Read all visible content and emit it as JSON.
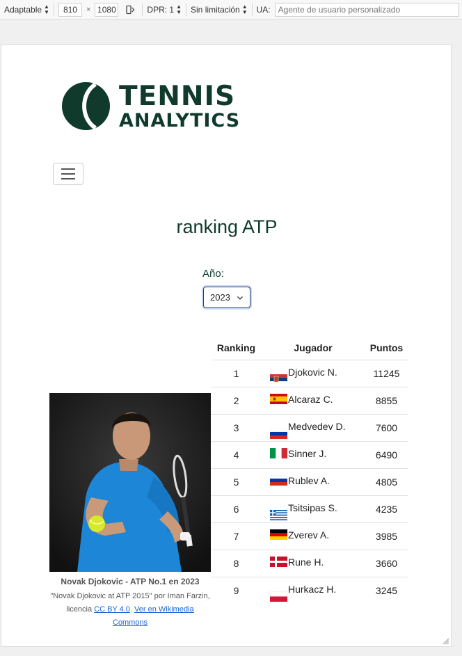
{
  "toolbar": {
    "device": "Adaptable",
    "width": "810",
    "times": "×",
    "height": "1080",
    "dpr": "DPR: 1",
    "throttle": "Sin limitación",
    "ua_label": "UA:",
    "ua_placeholder": "Agente de usuario personalizado"
  },
  "brand": {
    "line1": "TENNIS",
    "line2": "ANALYTICS",
    "color": "#0f3a2c"
  },
  "page": {
    "title": "ranking ATP",
    "year_label": "Año:",
    "year_value": "2023"
  },
  "table": {
    "headers": {
      "rank": "Ranking",
      "player": "Jugador",
      "points": "Puntos"
    },
    "rows": [
      {
        "rank": "1",
        "player": "Djokovic N.",
        "points": "11245",
        "flag": "serbia-flag-icon"
      },
      {
        "rank": "2",
        "player": "Alcaraz C.",
        "points": "8855",
        "flag": "spain-flag-icon"
      },
      {
        "rank": "3",
        "player": "Medvedev D.",
        "points": "7600",
        "flag": "russia-flag-icon"
      },
      {
        "rank": "4",
        "player": "Sinner J.",
        "points": "6490",
        "flag": "italy-flag-icon"
      },
      {
        "rank": "5",
        "player": "Rublev A.",
        "points": "4805",
        "flag": "russia-flag-icon"
      },
      {
        "rank": "6",
        "player": "Tsitsipas S.",
        "points": "4235",
        "flag": "greece-flag-icon"
      },
      {
        "rank": "7",
        "player": "Zverev A.",
        "points": "3985",
        "flag": "germany-flag-icon"
      },
      {
        "rank": "8",
        "player": "Rune H.",
        "points": "3660",
        "flag": "denmark-flag-icon"
      },
      {
        "rank": "9",
        "player": "Hurkacz H.",
        "points": "3245",
        "flag": "poland-flag-icon"
      }
    ]
  },
  "photo": {
    "caption_title": "Novak Djokovic - ATP No.1 en 2023",
    "credit_text": "\"Novak Djokovic at ATP 2015\" por Iman Farzin, licencia",
    "license_link": "CC BY 4.0",
    "separator": ".",
    "wiki_link": "Ver en Wikimedia Commons"
  }
}
